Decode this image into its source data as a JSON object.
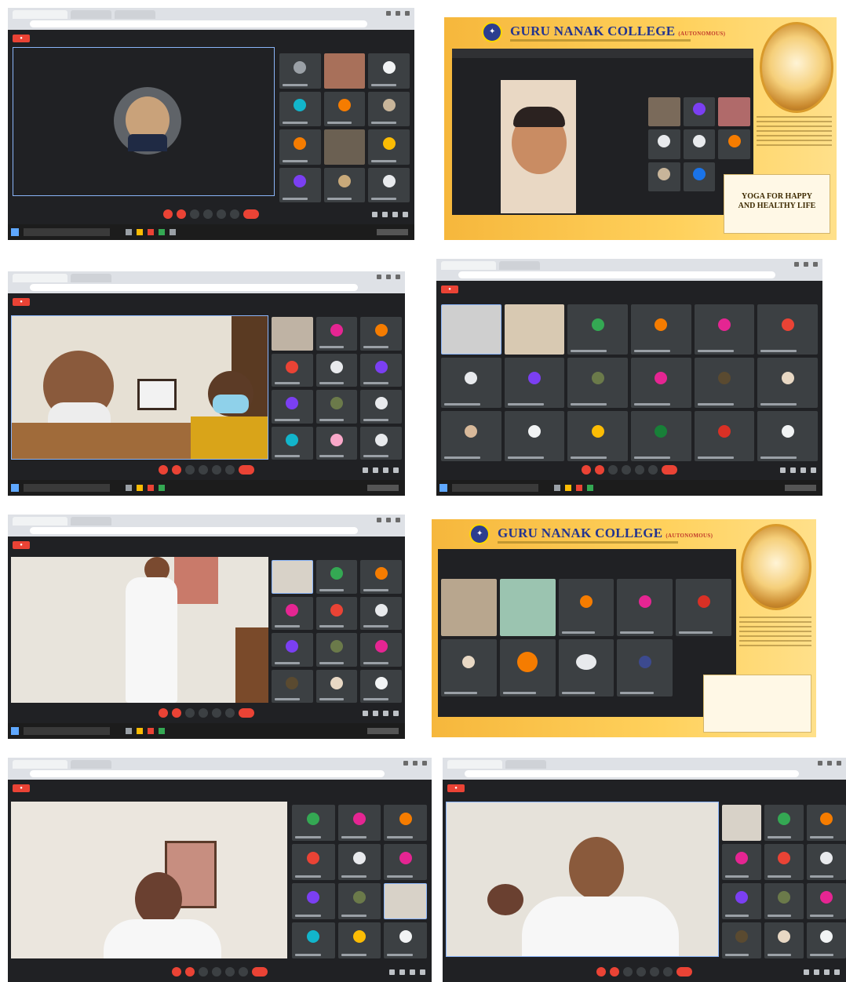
{
  "college": {
    "name": "GURU NANAK COLLEGE",
    "qualifier": "(AUTONOMOUS)"
  },
  "event_card": {
    "line1": "YOGA FOR HAPPY",
    "line2": "AND HEALTHY LIFE"
  },
  "colors": {
    "meet_bg": "#202124",
    "tile_bg": "#3c4043",
    "record": "#ea4335",
    "banner": "#ffd15c",
    "college_text": "#23348f"
  },
  "icons": {
    "record": "record-icon",
    "mic": "mic-icon",
    "camera": "camera-icon",
    "end_call": "end-call-icon",
    "logo": "college-logo-icon"
  },
  "avatar_colors": [
    "#34a853",
    "#e52592",
    "#f57c00",
    "#7b3ff2",
    "#ea4335",
    "#12b5cb",
    "#fbbc04",
    "#9aa0a6"
  ]
}
